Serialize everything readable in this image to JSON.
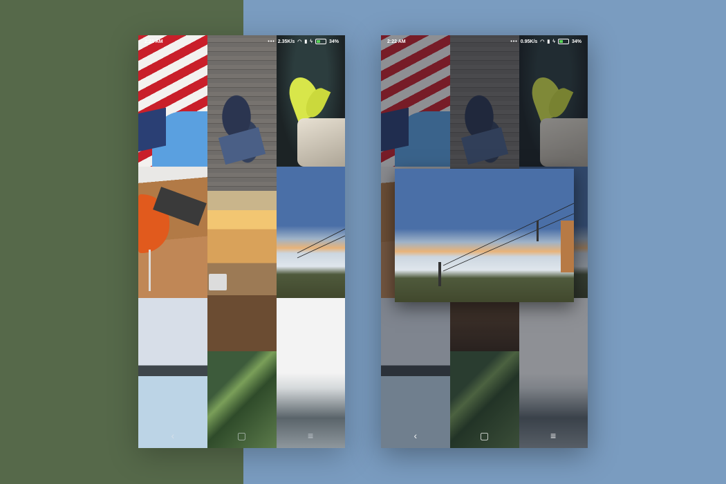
{
  "screens": [
    {
      "id": "grid-view",
      "status": {
        "time": "2:21 AM",
        "network_speed": "2.35K/s",
        "battery": "34%"
      },
      "nav": {
        "back": "‹",
        "home": "▢",
        "menu": "≡"
      }
    },
    {
      "id": "peek-view",
      "status": {
        "time": "2:22 AM",
        "network_speed": "0.95K/s",
        "battery": "34%"
      },
      "nav": {
        "back": "‹",
        "home": "▢",
        "menu": "≡"
      }
    }
  ],
  "colors": {
    "left_background": "#56694a",
    "right_background": "#7a9cc0"
  }
}
